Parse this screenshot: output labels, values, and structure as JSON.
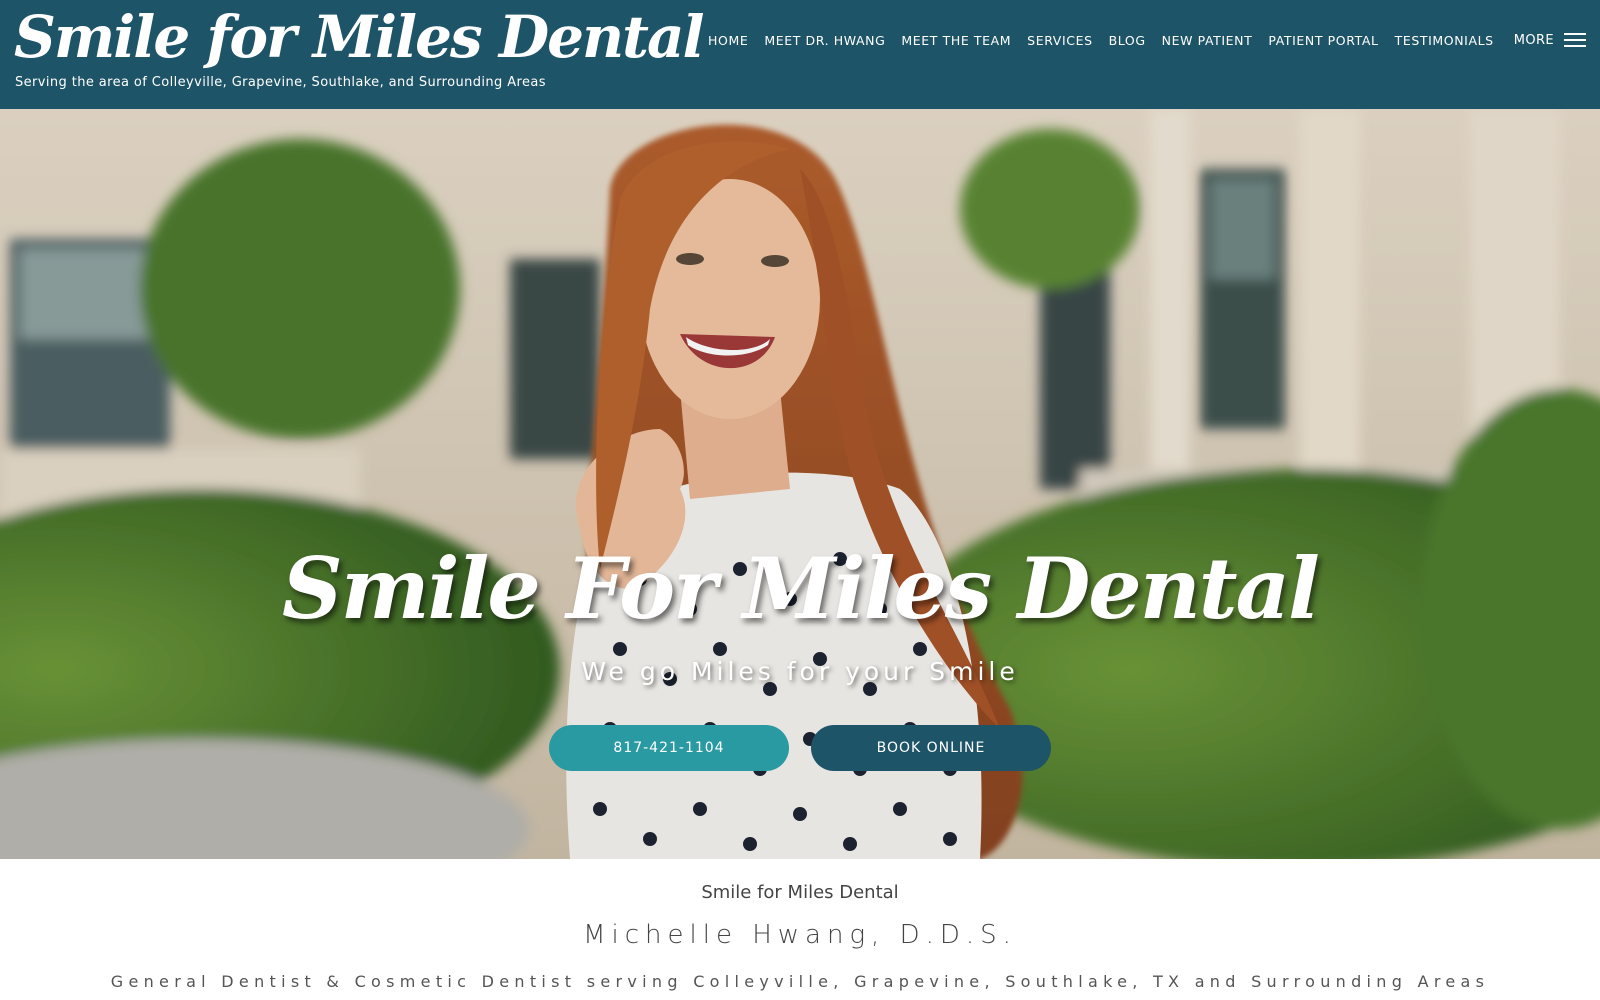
{
  "header": {
    "logo_title": "Smile for Miles Dental",
    "logo_subtitle": "Serving the area of Colleyville, Grapevine, Southlake, and Surrounding Areas",
    "nav": [
      {
        "label": "HOME"
      },
      {
        "label": "MEET DR. HWANG"
      },
      {
        "label": "MEET THE TEAM"
      },
      {
        "label": "SERVICES"
      },
      {
        "label": "BLOG"
      },
      {
        "label": "NEW PATIENT"
      },
      {
        "label": "PATIENT PORTAL"
      },
      {
        "label": "TESTIMONIALS"
      }
    ],
    "more_label": "MORE",
    "more_icon": "hamburger-menu-icon",
    "background_color": "#1e5468"
  },
  "hero": {
    "title": "Smile For Miles Dental",
    "tagline": "We go Miles for your Smile",
    "phone_button": "817-421-1104",
    "book_button": "BOOK ONLINE",
    "phone_button_color": "#2a9aa2",
    "book_button_color": "#1e5468",
    "image_description_icon": "smiling-woman-photo"
  },
  "intro": {
    "practice_name": "Smile for Miles Dental",
    "doctor_name": "Michelle Hwang, D.D.S.",
    "description": "General Dentist & Cosmetic Dentist serving Colleyville, Grapevine, Southlake, TX and Surrounding Areas"
  }
}
